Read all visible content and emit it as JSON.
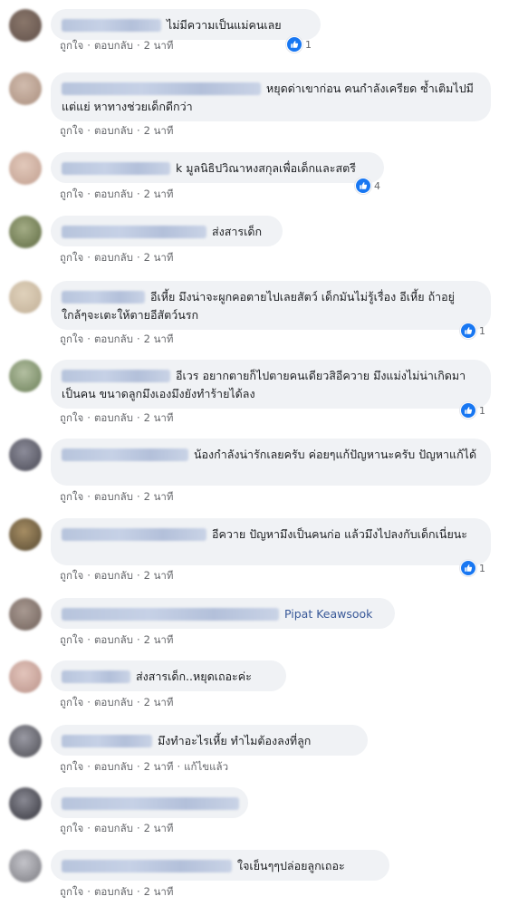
{
  "labels": {
    "like": "ถูกใจ",
    "reply": "ตอบกลับ",
    "dot": "·",
    "edited": "แก้ไขแล้ว"
  },
  "colors": {
    "bubble": "#f0f2f5",
    "meta_text": "#65676b",
    "like_blue": "#1877f2",
    "link": "#385898"
  },
  "comments": [
    {
      "text": "ไม่มีความเป็นแม่คนเลย",
      "time": "2 นาที",
      "reactions": "1"
    },
    {
      "text": "หยุดด่าเขาก่อน คนกำลังเครียด ซ้ำเติมไปมีแต่แย่ หาทางช่วยเด็กดีกว่า",
      "time": "2 นาที"
    },
    {
      "text": "k มูลนิธิปวิณาหงสกุลเพื่อเด็กและสตรี",
      "time": "2 นาที",
      "reactions": "4"
    },
    {
      "text": "ส่งสารเด็ก",
      "time": "2 นาที"
    },
    {
      "text": "อีเหี้ย มึงน่าจะผูกคอตายไปเลยสัตว์ เด็กมันไม่รู้เรื่อง อีเหี้ย ถ้าอยู่ใกล้ๆจะเตะให้ตายอีสัตว์นรก",
      "time": "2 นาที",
      "reactions": "1"
    },
    {
      "text": "อีเวร อยากตายก็ไปตายคนเดียวสิอีควาย มึงแม่งไม่น่าเกิดมาเป็นคน ขนาดลูกมึงเองมึงยังทำร้ายได้ลง",
      "time": "2 นาที",
      "reactions": "1"
    },
    {
      "text": "น้องกำลังน่ารักเลยครับ ค่อยๆแก้ปัญหานะครับ ปัญหาแก้ได้",
      "time": "2 นาที"
    },
    {
      "text": "อีควาย ปัญหามึงเป็นคนก่อ แล้วมึงไปลงกับเด็กเนี่ยนะ",
      "time": "2 นาที",
      "reactions": "1"
    },
    {
      "text": "",
      "tag": "Pipat Keawsook",
      "time": "2 นาที"
    },
    {
      "text": "ส่งสารเด็ก..หยุดเถอะค่ะ",
      "time": "2 นาที"
    },
    {
      "text": "มึงทำอะไรเหี้ย ทำไมต้องลงที่ลูก",
      "time": "2 นาที",
      "edited": true
    },
    {
      "text": "",
      "time": "2 นาที"
    },
    {
      "text": "ใจเย็นๆๆปล่อยลูกเถอะ",
      "time": "2 นาที"
    }
  ]
}
